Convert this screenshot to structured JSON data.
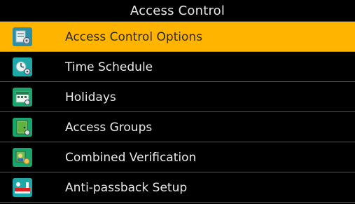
{
  "header": {
    "title": "Access Control"
  },
  "menu": {
    "items": [
      {
        "label": "Access Control Options",
        "icon": "options-gear-icon",
        "selected": true
      },
      {
        "label": "Time Schedule",
        "icon": "clock-settings-icon",
        "selected": false
      },
      {
        "label": "Holidays",
        "icon": "calendar-icon",
        "selected": false
      },
      {
        "label": "Access Groups",
        "icon": "door-group-icon",
        "selected": false
      },
      {
        "label": "Combined Verification",
        "icon": "combined-verification-icon",
        "selected": false
      },
      {
        "label": "Anti-passback Setup",
        "icon": "anti-passback-icon",
        "selected": false
      }
    ]
  },
  "colors": {
    "background": "#000000",
    "selected": "#ffb400",
    "icon_teal": "#1fa8a8"
  }
}
